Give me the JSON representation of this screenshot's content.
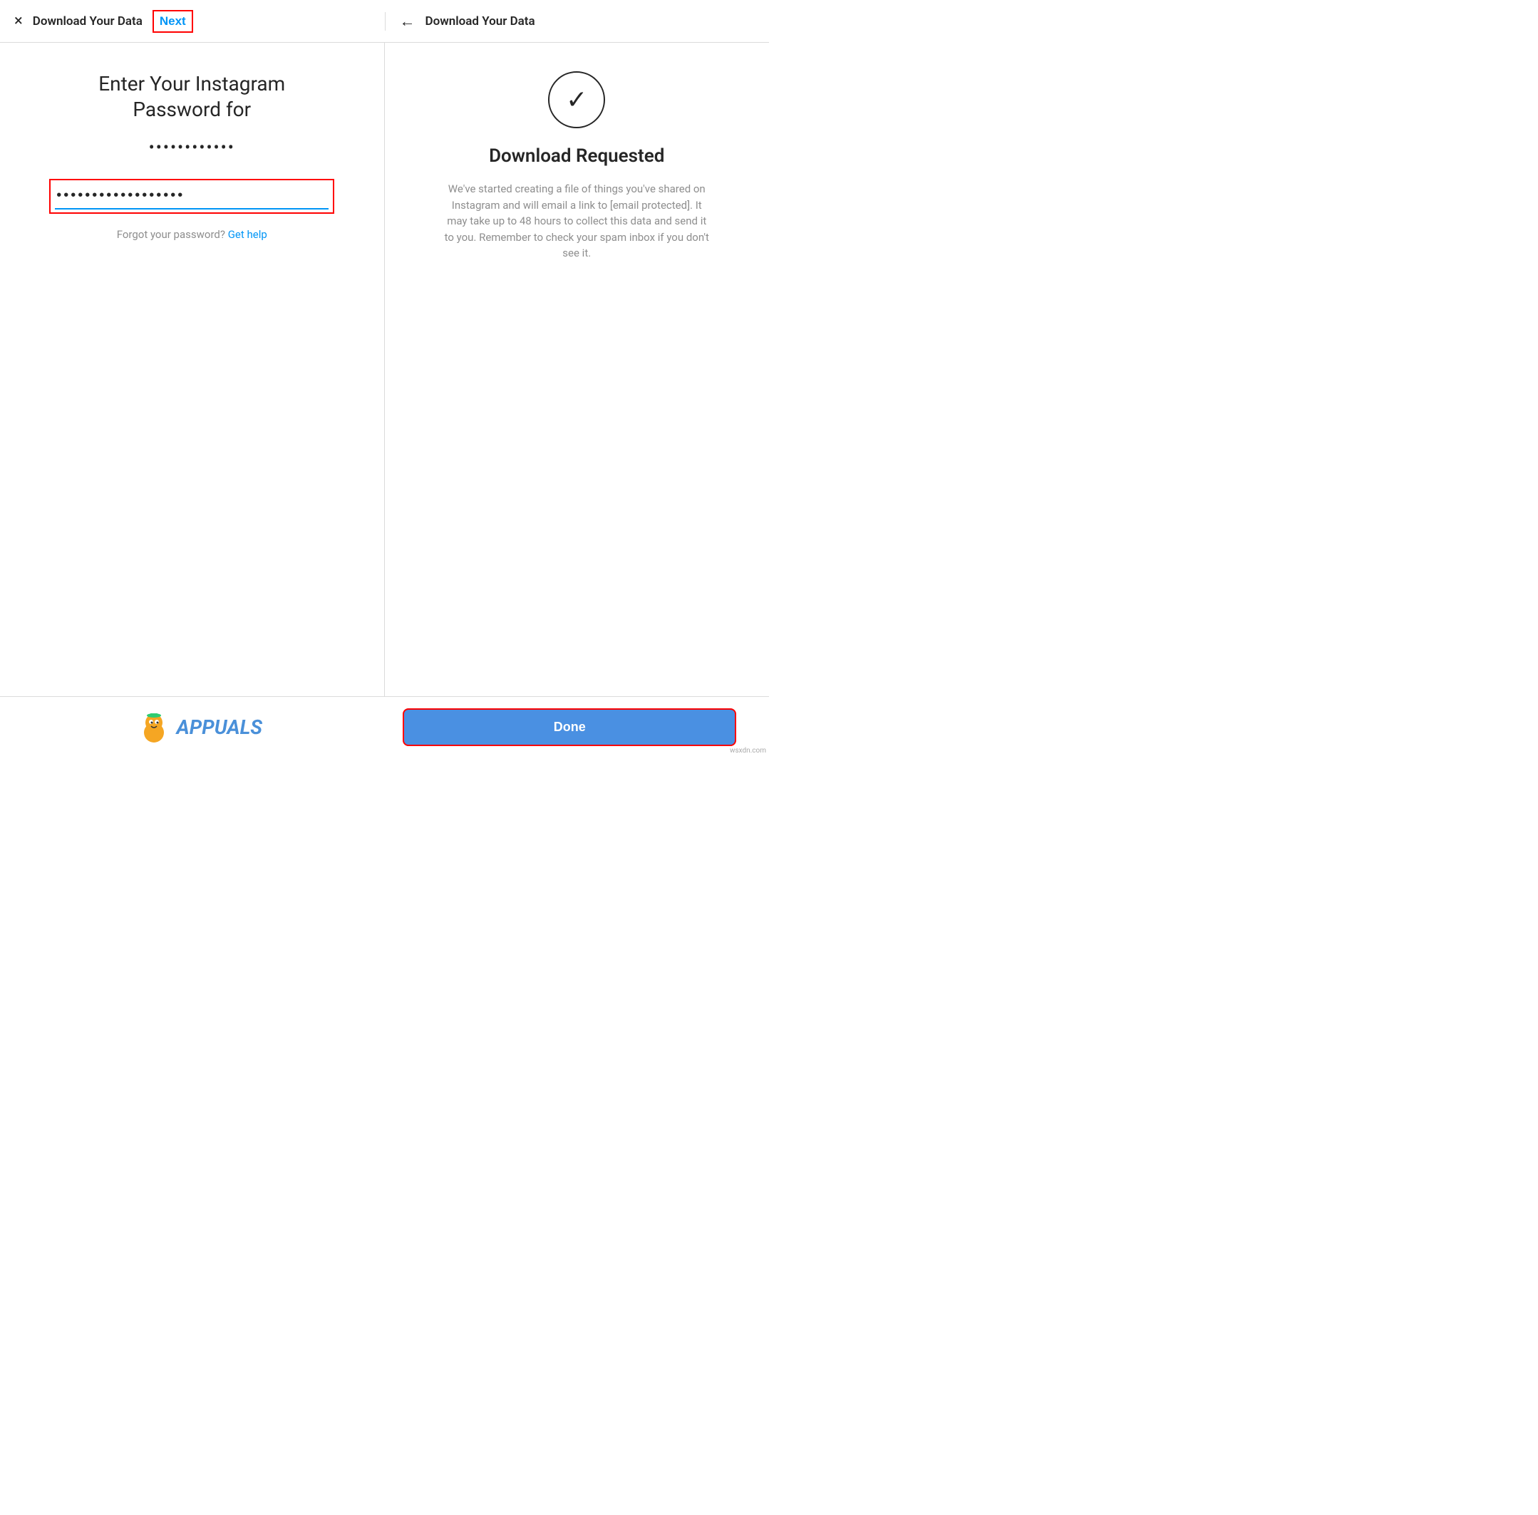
{
  "header": {
    "left": {
      "close_label": "×",
      "title": "Download Your Data",
      "next_label": "Next"
    },
    "right": {
      "back_label": "←",
      "title": "Download Your Data"
    }
  },
  "left_panel": {
    "heading_line1": "Enter Your Instagram",
    "heading_line2": "Password for",
    "username_dots": "••••••••••••",
    "password_value": "••••••••••••••••••",
    "forgot_text": "Forgot your password?",
    "get_help_label": "Get help"
  },
  "right_panel": {
    "checkmark": "✓",
    "title": "Download Requested",
    "description": "We've started creating a file of things you've shared on Instagram and will email a link to [email protected]. It may take up to 48 hours to collect this data and send it to you. Remember to check your spam inbox if you don't see it."
  },
  "bottom_bar": {
    "logo_text": "APPUALS",
    "done_label": "Done"
  },
  "watermark": "wsxdn.com"
}
